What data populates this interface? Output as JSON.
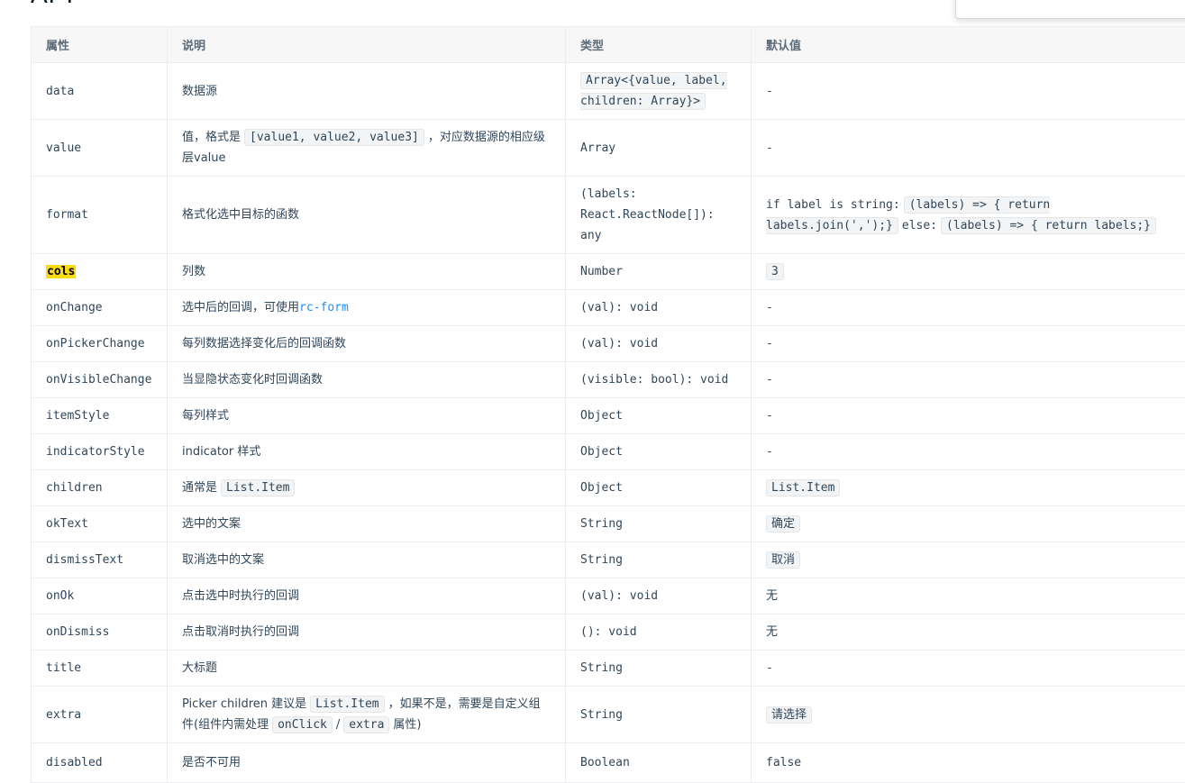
{
  "page": {
    "heading": "API"
  },
  "table": {
    "headers": [
      "属性",
      "说明",
      "类型",
      "默认值"
    ],
    "rows": [
      {
        "prop": "data",
        "desc": "数据源",
        "type_chip": "Array<{value, label, children: Array}>",
        "default": "-"
      },
      {
        "prop": "value",
        "desc_pre": "值，格式是",
        "desc_code": "[value1, value2, value3]",
        "desc_post": "，对应数据源的相应级层value",
        "type": "Array",
        "default": "-"
      },
      {
        "prop": "format",
        "desc": "格式化选中目标的函数",
        "type": "(labels: React.ReactNode[]): any",
        "default_pre": "if label is string:",
        "default_code1": "(labels) => { return labels.join(',');}",
        "default_mid": "else:",
        "default_code2": "(labels) => { return labels;}"
      },
      {
        "prop": "cols",
        "desc": "列数",
        "type": "Number",
        "default_chip": "3"
      },
      {
        "prop": "onChange",
        "desc_pre": "选中后的回调，可使用",
        "desc_link": "rc-form",
        "type": "(val): void",
        "default": "-"
      },
      {
        "prop": "onPickerChange",
        "desc": "每列数据选择变化后的回调函数",
        "type": "(val): void",
        "default": "-"
      },
      {
        "prop": "onVisibleChange",
        "desc": "当显隐状态变化时回调函数",
        "type": "(visible: bool): void",
        "default": "-"
      },
      {
        "prop": "itemStyle",
        "desc": "每列样式",
        "type": "Object",
        "default": "-"
      },
      {
        "prop": "indicatorStyle",
        "desc": "indicator 样式",
        "type": "Object",
        "default": "-"
      },
      {
        "prop": "children",
        "desc_pre": "通常是",
        "desc_code": "List.Item",
        "type": "Object",
        "default_chip": "List.Item"
      },
      {
        "prop": "okText",
        "desc": "选中的文案",
        "type": "String",
        "default_chip": "确定"
      },
      {
        "prop": "dismissText",
        "desc": "取消选中的文案",
        "type": "String",
        "default_chip": "取消"
      },
      {
        "prop": "onOk",
        "desc": "点击选中时执行的回调",
        "type": "(val): void",
        "default": "无"
      },
      {
        "prop": "onDismiss",
        "desc": "点击取消时执行的回调",
        "type": "(): void",
        "default": "无"
      },
      {
        "prop": "title",
        "desc": "大标题",
        "type": "String",
        "default": "-"
      },
      {
        "prop": "extra",
        "desc_pre": "Picker children 建议是",
        "desc_code": "List.Item",
        "desc_mid": "，如果不是，需要是自定义组件(组件内需处理",
        "desc_code2": "onClick",
        "desc_sep": "/",
        "desc_code3": "extra",
        "desc_post": "属性)",
        "type": "String",
        "default_chip": "请选择"
      },
      {
        "prop": "disabled",
        "desc": "是否不可用",
        "type": "Boolean",
        "default": "false"
      }
    ]
  }
}
